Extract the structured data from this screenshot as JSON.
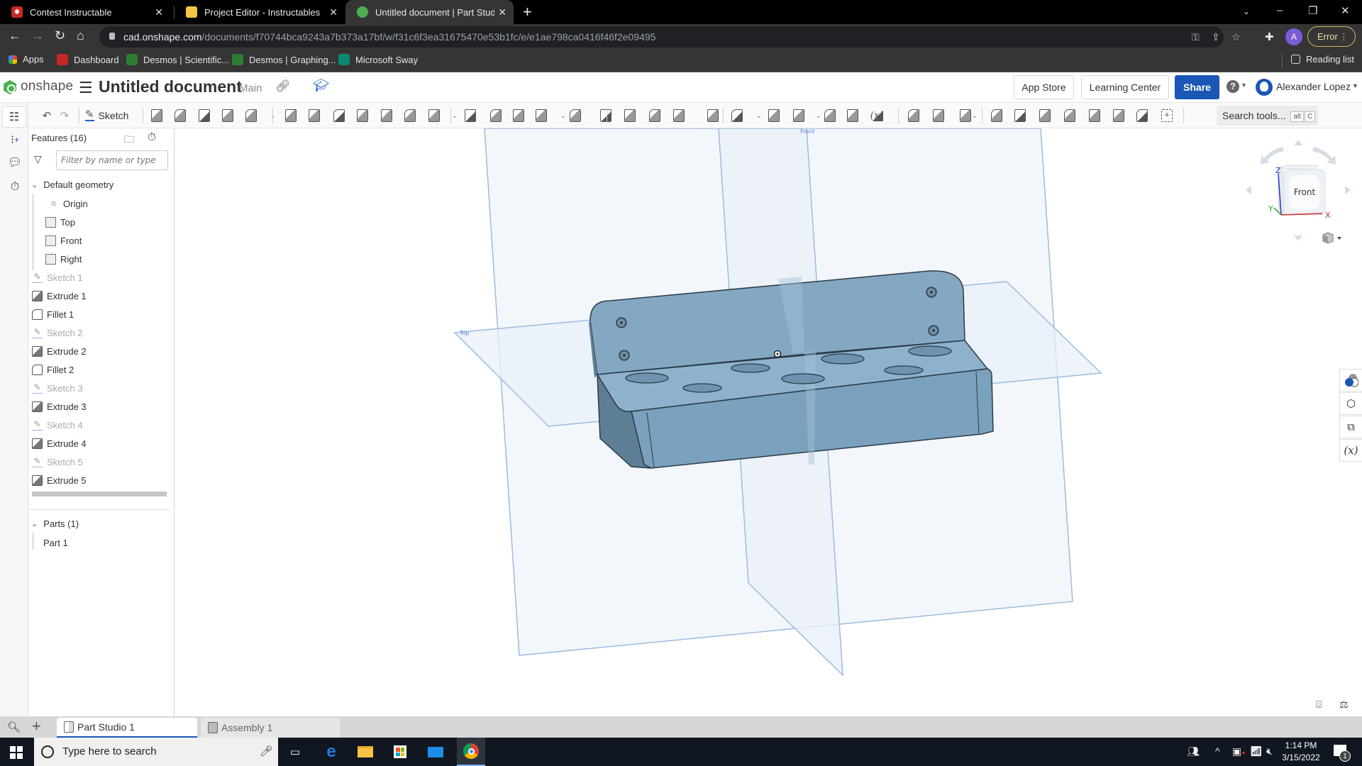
{
  "browser": {
    "tabs": [
      {
        "title": "Contest Instructable",
        "icon": "instructables-robot-icon",
        "active": false
      },
      {
        "title": "Project Editor - Instructables",
        "icon": "instructables-avatar-icon",
        "active": false
      },
      {
        "title": "Untitled document | Part Studio 1",
        "icon": "onshape-icon",
        "active": true
      }
    ],
    "new_tab": "+",
    "url_host": "cad.onshape.com",
    "url_path": "/documents/f70744bca9243a7b373a17bf/w/f31c6f3ea31675470e53b1fc/e/e1ae798ca0416f46f2e09495",
    "profile_initial": "A",
    "error_label": "Error",
    "bookmarks": [
      {
        "label": "Apps",
        "icon": "apps-grid-icon"
      },
      {
        "label": "Dashboard",
        "icon": "instructables-robot-icon"
      },
      {
        "label": "Desmos | Scientific...",
        "icon": "desmos-icon"
      },
      {
        "label": "Desmos | Graphing...",
        "icon": "desmos-icon"
      },
      {
        "label": "Microsoft Sway",
        "icon": "sway-icon"
      }
    ],
    "reading_list": "Reading list"
  },
  "header": {
    "logo": "onshape",
    "document_title": "Untitled document",
    "branch": "Main",
    "app_store": "App Store",
    "learning_center": "Learning Center",
    "share": "Share",
    "help": "?",
    "user_name": "Alexander Lopez",
    "accent_color": "#1a56b4"
  },
  "toolbar": {
    "sketch_label": "Sketch",
    "search_label": "Search tools...",
    "search_shortcut": [
      "alt",
      "C"
    ],
    "tools": [
      "extrude",
      "revolve",
      "sweep",
      "loft",
      "thicken",
      "fillet",
      "chamfer",
      "draft",
      "rib",
      "shell",
      "hole",
      "pattern",
      "mirror",
      "boolean",
      "split",
      "transform",
      "delete-part",
      "modify-fillet",
      "delete-face",
      "move-face",
      "replace-face",
      "offset-surface",
      "plane",
      "helix",
      "curve",
      "mate-connector",
      "derive",
      "variable",
      "configurations",
      "sheet-metal",
      "sheet-metal-flange",
      "sheet-metal-tab",
      "frame",
      "frame-trim",
      "gusset",
      "extend",
      "bend-relief",
      "finish-sheet-metal",
      "section-view"
    ]
  },
  "features": {
    "header": "Features (16)",
    "filter_placeholder": "Filter by name or type",
    "default_geometry_label": "Default geometry",
    "default_geometry": [
      {
        "name": "Origin",
        "type": "origin"
      },
      {
        "name": "Top",
        "type": "plane"
      },
      {
        "name": "Front",
        "type": "plane"
      },
      {
        "name": "Right",
        "type": "plane"
      }
    ],
    "items": [
      {
        "name": "Sketch 1",
        "type": "sketch"
      },
      {
        "name": "Extrude 1",
        "type": "extrude"
      },
      {
        "name": "Fillet 1",
        "type": "fillet"
      },
      {
        "name": "Sketch 2",
        "type": "sketch"
      },
      {
        "name": "Extrude 2",
        "type": "extrude"
      },
      {
        "name": "Fillet 2",
        "type": "fillet"
      },
      {
        "name": "Sketch 3",
        "type": "sketch"
      },
      {
        "name": "Extrude 3",
        "type": "extrude"
      },
      {
        "name": "Sketch 4",
        "type": "sketch"
      },
      {
        "name": "Extrude 4",
        "type": "extrude"
      },
      {
        "name": "Sketch 5",
        "type": "sketch"
      },
      {
        "name": "Extrude 5",
        "type": "extrude"
      }
    ],
    "parts_label": "Parts (1)",
    "parts": [
      "Part 1"
    ]
  },
  "viewport": {
    "view_cube_face": "Front",
    "axes": {
      "x": "X",
      "y": "Y",
      "z": "Z"
    },
    "part_color": "#7fa6c1",
    "plane_color": "#b9cde6"
  },
  "bottom_tabs": [
    {
      "label": "Part Studio 1",
      "active": true
    },
    {
      "label": "Assembly 1",
      "active": false
    }
  ],
  "taskbar": {
    "search_placeholder": "Type here to search",
    "time": "1:14 PM",
    "date": "3/15/2022",
    "notification_count": "1"
  }
}
